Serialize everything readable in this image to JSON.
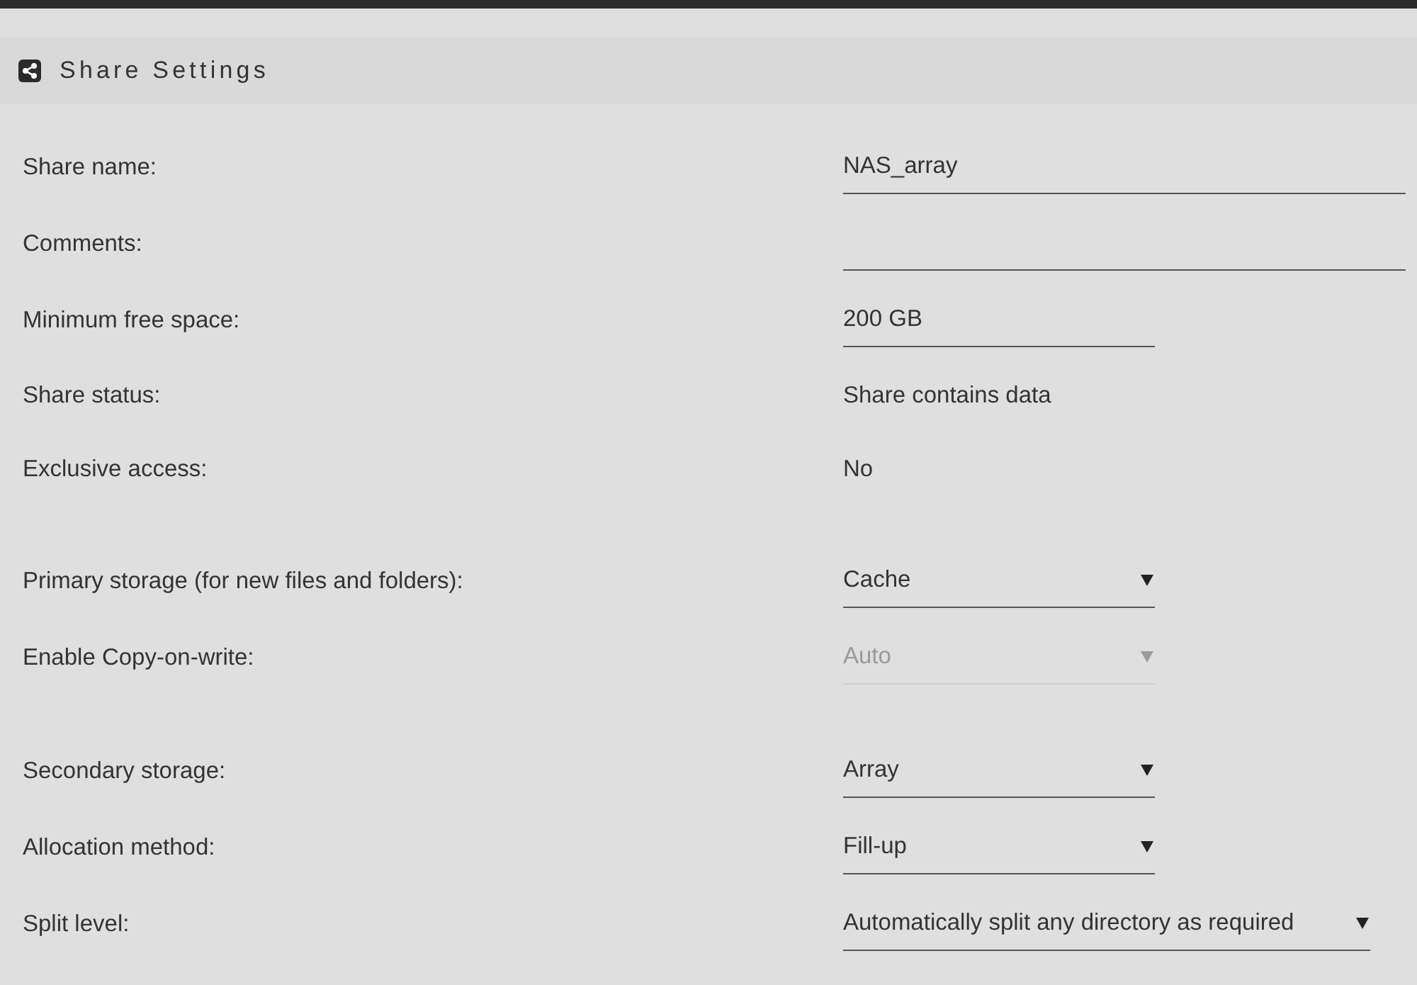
{
  "panel": {
    "title": "Share Settings"
  },
  "sections": [
    {
      "fields": [
        {
          "kind": "text",
          "label": "Share name:",
          "value": "NAS_array",
          "disabled": false
        },
        {
          "kind": "text",
          "label": "Comments:",
          "disabled": false
        },
        {
          "kind": "size",
          "label": "Minimum free space:",
          "value": "200 GB",
          "disabled": false
        },
        {
          "kind": "status",
          "label": "Share status:",
          "value": "Share contains data",
          "disabled": false
        },
        {
          "kind": "status",
          "label": "Exclusive access:",
          "value": "No",
          "disabled": false
        }
      ]
    },
    {
      "fields": [
        {
          "kind": "select",
          "label": "Primary storage (for new files and folders):",
          "value": "Cache",
          "disabled": false
        },
        {
          "kind": "select",
          "label": "Enable Copy-on-write:",
          "value": "Auto",
          "disabled": true
        }
      ]
    },
    {
      "fields": [
        {
          "kind": "select",
          "label": "Secondary storage:",
          "value": "Array",
          "disabled": false
        },
        {
          "kind": "select",
          "label": "Allocation method:",
          "value": "Fill-up",
          "disabled": false
        },
        {
          "kind": "select",
          "label": "Split level:",
          "value": "Automatically split any directory as required",
          "disabled": false
        }
      ]
    }
  ]
}
